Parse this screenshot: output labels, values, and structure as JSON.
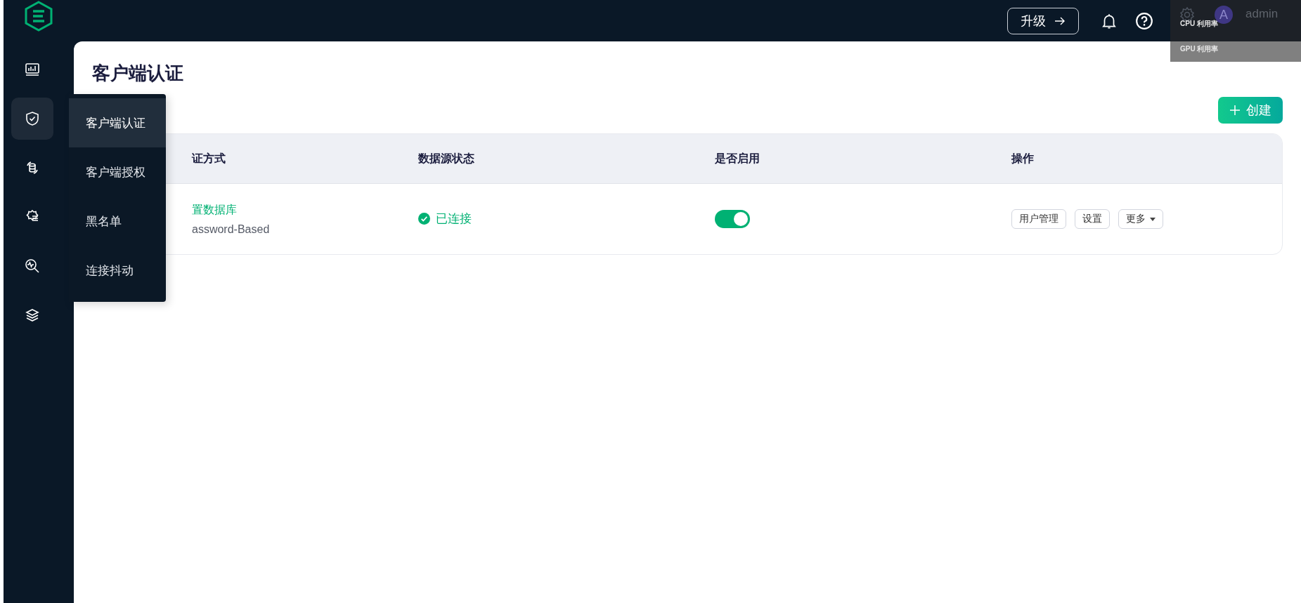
{
  "header": {
    "upgrade_button": "升级",
    "user": {
      "avatar": "A",
      "name": "admin"
    }
  },
  "monitor_overlay": {
    "metrics": [
      "CPU 利用率",
      "GPU 利用率"
    ]
  },
  "sidebar": {
    "items": [
      {
        "selected": false
      },
      {
        "selected": true
      },
      {
        "selected": false
      },
      {
        "selected": false
      },
      {
        "selected": false
      },
      {
        "selected": false
      }
    ]
  },
  "flyout_menu": {
    "items": [
      {
        "label": "客户端认证",
        "selected": true
      },
      {
        "label": "客户端授权",
        "selected": false
      },
      {
        "label": "黑名单",
        "selected": false
      },
      {
        "label": "连接抖动",
        "selected": false
      }
    ]
  },
  "page": {
    "title": "客户端认证",
    "create_button": "创建"
  },
  "table": {
    "columns": [
      "证方式",
      "数据源状态",
      "是否启用",
      "操作"
    ],
    "rows": [
      {
        "name": "置数据库",
        "mechanism": "assword-Based",
        "status": "已连接",
        "connected": true,
        "enabled": true,
        "actions": [
          "用户管理",
          "设置"
        ],
        "more": "更多"
      }
    ]
  }
}
